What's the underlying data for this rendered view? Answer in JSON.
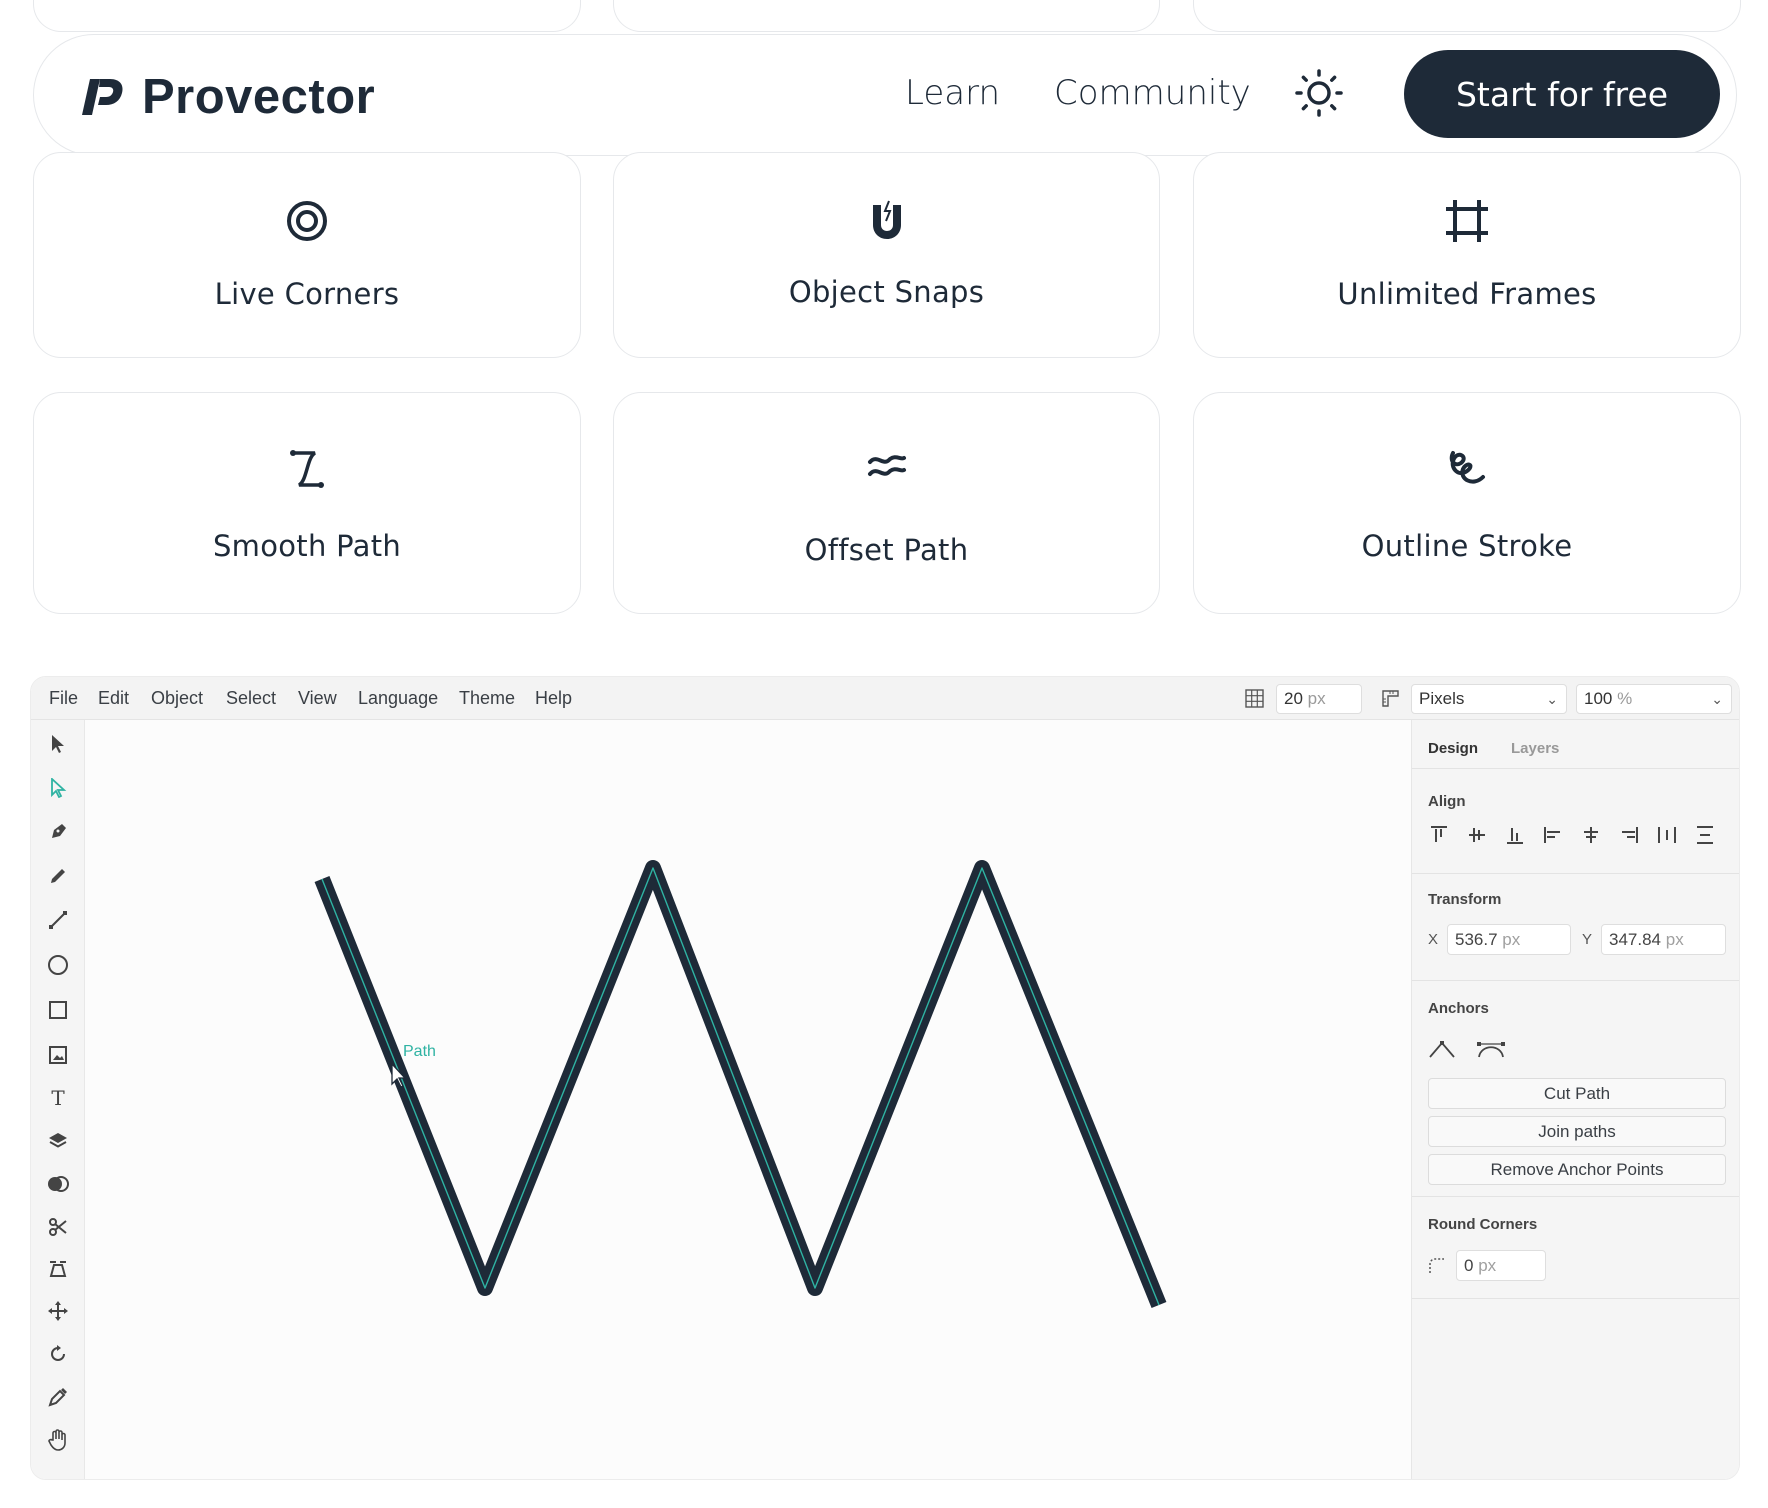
{
  "navbar": {
    "brand": "Provector",
    "links": [
      "Learn",
      "Community"
    ],
    "cta": "Start for free",
    "theme_icon": "sun-icon"
  },
  "features": [
    {
      "label": "Live Corners",
      "icon": "target-icon"
    },
    {
      "label": "Object Snaps",
      "icon": "magnet-icon"
    },
    {
      "label": "Unlimited Frames",
      "icon": "frame-icon"
    },
    {
      "label": "Smooth Path",
      "icon": "smooth-path-icon"
    },
    {
      "label": "Offset Path",
      "icon": "approx-icon"
    },
    {
      "label": "Outline Stroke",
      "icon": "scribble-icon"
    }
  ],
  "editor": {
    "menu": [
      "File",
      "Edit",
      "Object",
      "Select",
      "View",
      "Language",
      "Theme",
      "Help"
    ],
    "grid_size": {
      "value": "20",
      "unit": "px"
    },
    "units_select": "Pixels",
    "zoom_select": {
      "value": "100",
      "unit": "%"
    },
    "canvas": {
      "hover_label": "Path",
      "stroke_color": "#1e2a38",
      "highlight_color": "#2fb3a3"
    },
    "panel": {
      "tabs": [
        "Design",
        "Layers"
      ],
      "active_tab": "Design",
      "align_title": "Align",
      "transform_title": "Transform",
      "x_label": "X",
      "x_value": "536.7",
      "y_label": "Y",
      "y_value": "347.84",
      "unit": "px",
      "anchors_title": "Anchors",
      "buttons": [
        "Cut Path",
        "Join paths",
        "Remove Anchor Points"
      ],
      "round_corners_title": "Round Corners",
      "round_corners_value": "0"
    }
  }
}
